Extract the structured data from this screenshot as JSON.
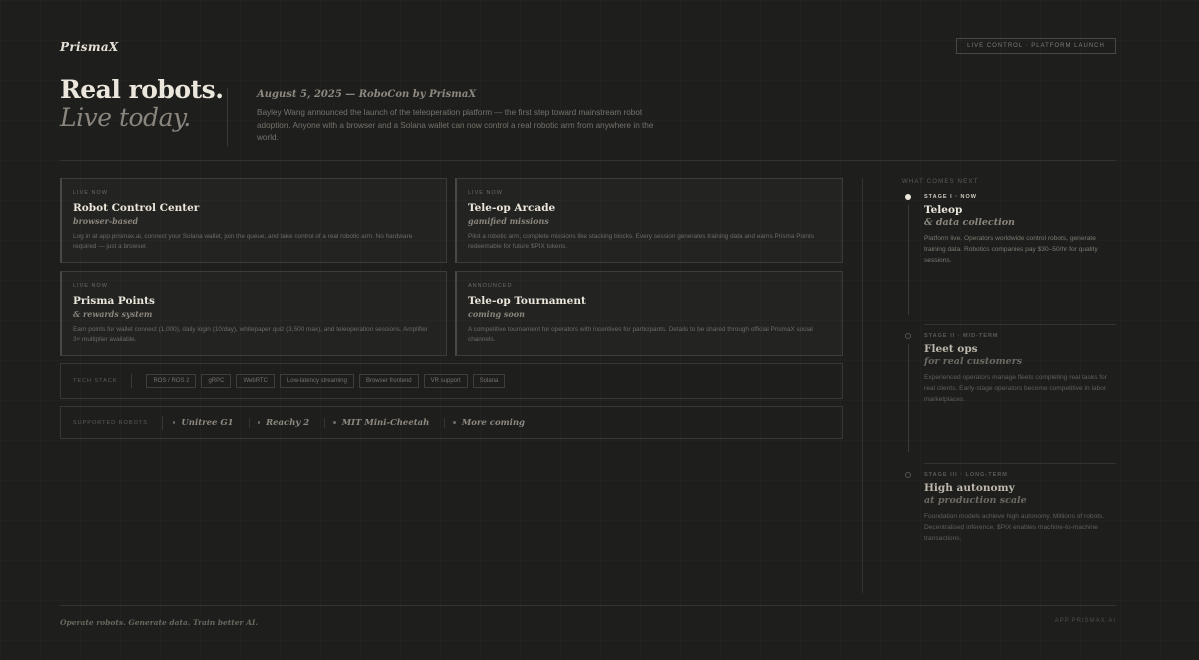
{
  "header": {
    "logo": "PrismaX",
    "badge": "LIVE CONTROL · PLATFORM LAUNCH"
  },
  "hero": {
    "title_line1": "Real robots.",
    "title_line2": "Live today.",
    "date": "August 5, 2025 — RoboCon by PrismaX",
    "text": "Bayley Wang announced the launch of the teleoperation platform — the first step toward mainstream robot adoption. Anyone with a browser and a Solana wallet can now control a real robotic arm from anywhere in the world."
  },
  "cards": [
    {
      "tag": "LIVE NOW",
      "title": "Robot Control Center",
      "sub": "browser-based",
      "desc": "Log in at app.prismax.ai, connect your Solana wallet, join the queue, and take control of a real robotic arm. No hardware required — just a browser."
    },
    {
      "tag": "LIVE NOW",
      "title": "Tele-op Arcade",
      "sub": "gamified missions",
      "desc": "Pilot a robotic arm, complete missions like stacking blocks. Every session generates training data and earns Prisma Points redeemable for future $PIX tokens."
    },
    {
      "tag": "LIVE NOW",
      "title": "Prisma Points",
      "sub": "& rewards system",
      "desc": "Earn points for wallet connect (1,000), daily login (10/day), whitepaper quiz (3,500 max), and teleoperation sessions. Amplifier 3× multiplier available."
    },
    {
      "tag": "ANNOUNCED",
      "title": "Tele-op Tournament",
      "sub": "coming soon",
      "desc": "A competitive tournament for operators with incentives for participants. Details to be shared through official PrismaX social channels."
    }
  ],
  "tech_stack": {
    "label": "TECH STACK",
    "items": [
      "ROS / ROS 2",
      "gRPC",
      "WebRTC",
      "Low-latency streaming",
      "Browser frontend",
      "VR support",
      "Solana"
    ]
  },
  "robots": {
    "label": "SUPPORTED ROBOTS",
    "items": [
      "Unitree G1",
      "Reachy 2",
      "MIT Mini-Cheetah",
      "More coming"
    ]
  },
  "roadmap": {
    "label": "WHAT COMES NEXT",
    "stages": [
      {
        "tag": "STAGE I · NOW",
        "title": "Teleop",
        "sub": "& data collection",
        "desc": "Platform live. Operators worldwide control robots, generate training data. Robotics companies pay $30–50/hr for quality sessions.",
        "active": true
      },
      {
        "tag": "STAGE II · MID-TERM",
        "title": "Fleet ops",
        "sub": "for real customers",
        "desc": "Experienced operators manage fleets completing real tasks for real clients. Early-stage operators become competitive in labor marketplaces.",
        "active": false
      },
      {
        "tag": "STAGE III · LONG-TERM",
        "title": "High autonomy",
        "sub": "at production scale",
        "desc": "Foundation models achieve high autonomy. Millions of robots. Decentralised inference. $PIX enables machine-to-machine transactions.",
        "active": false
      }
    ]
  },
  "footer": {
    "tagline": "Operate robots. Generate data. Train better AI.",
    "url": "APP.PRISMAX.AI"
  },
  "colors": {
    "background": "#1e1e1d",
    "text_primary": "#ebe6db",
    "text_muted": "#77736b"
  }
}
